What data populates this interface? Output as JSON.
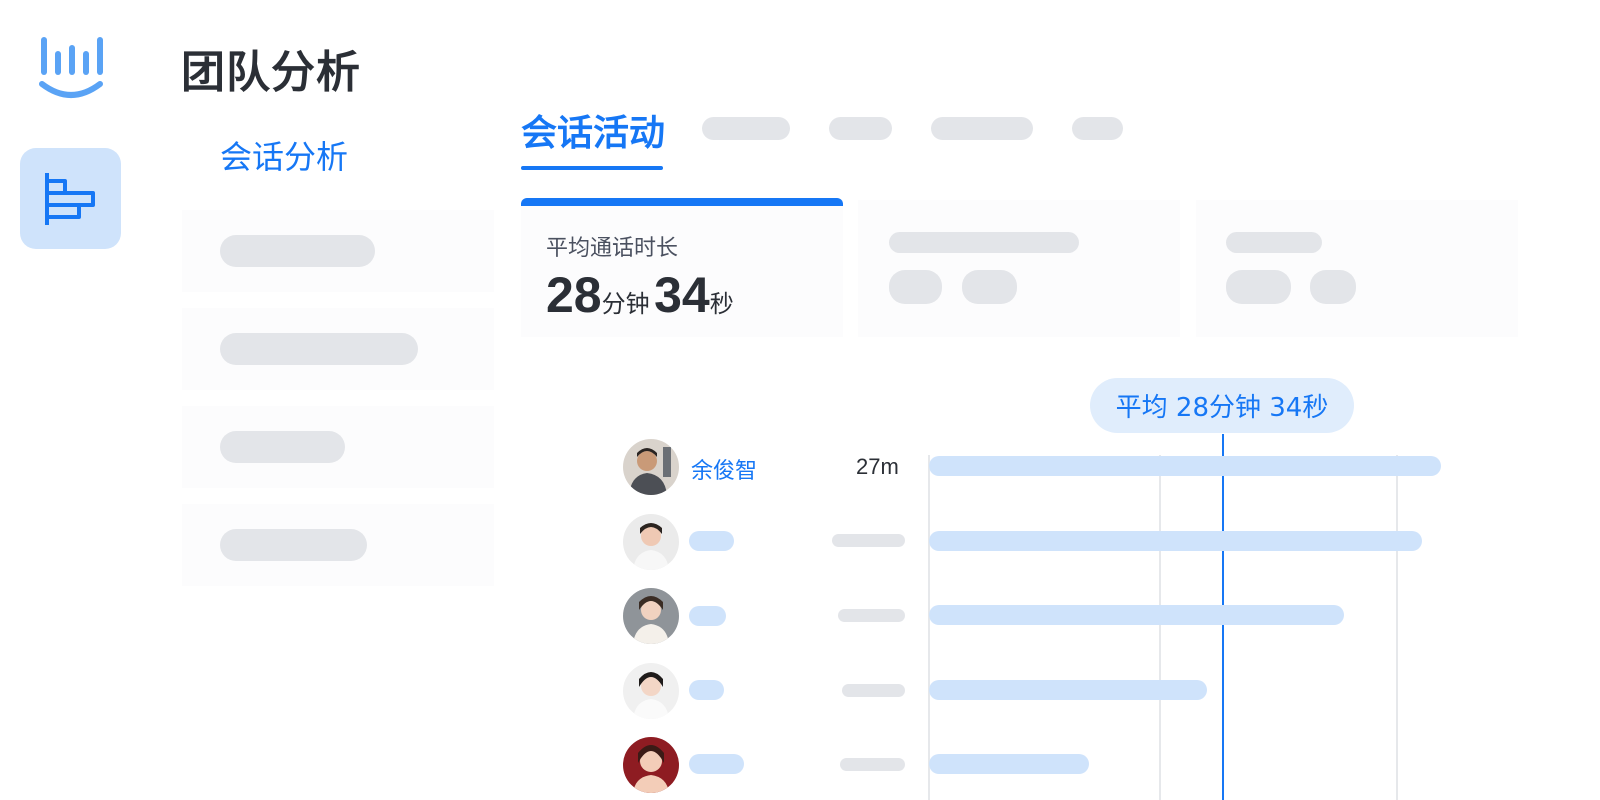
{
  "app": {
    "title": "团队分析",
    "logo_icon": "bar-chart-smile-logo",
    "rail_icon": "horizontal-bars-icon"
  },
  "subnav": {
    "active_label": "会话分析"
  },
  "tabs": {
    "active_label": "会话活动"
  },
  "stat": {
    "label": "平均通话时长",
    "minutes": "28",
    "minutes_unit": "分钟",
    "seconds": "34",
    "seconds_unit": "秒"
  },
  "average_tooltip": {
    "label": "平均  28分钟 34秒"
  },
  "chart_data": {
    "type": "bar",
    "orientation": "horizontal",
    "series": [
      {
        "name": "余俊智",
        "value_label": "27m"
      }
    ],
    "average_label": "平均  28分钟 34秒"
  },
  "colors": {
    "accent": "#1677f5",
    "bar": "#cfe3fb",
    "skeleton": "#e3e5e9"
  }
}
